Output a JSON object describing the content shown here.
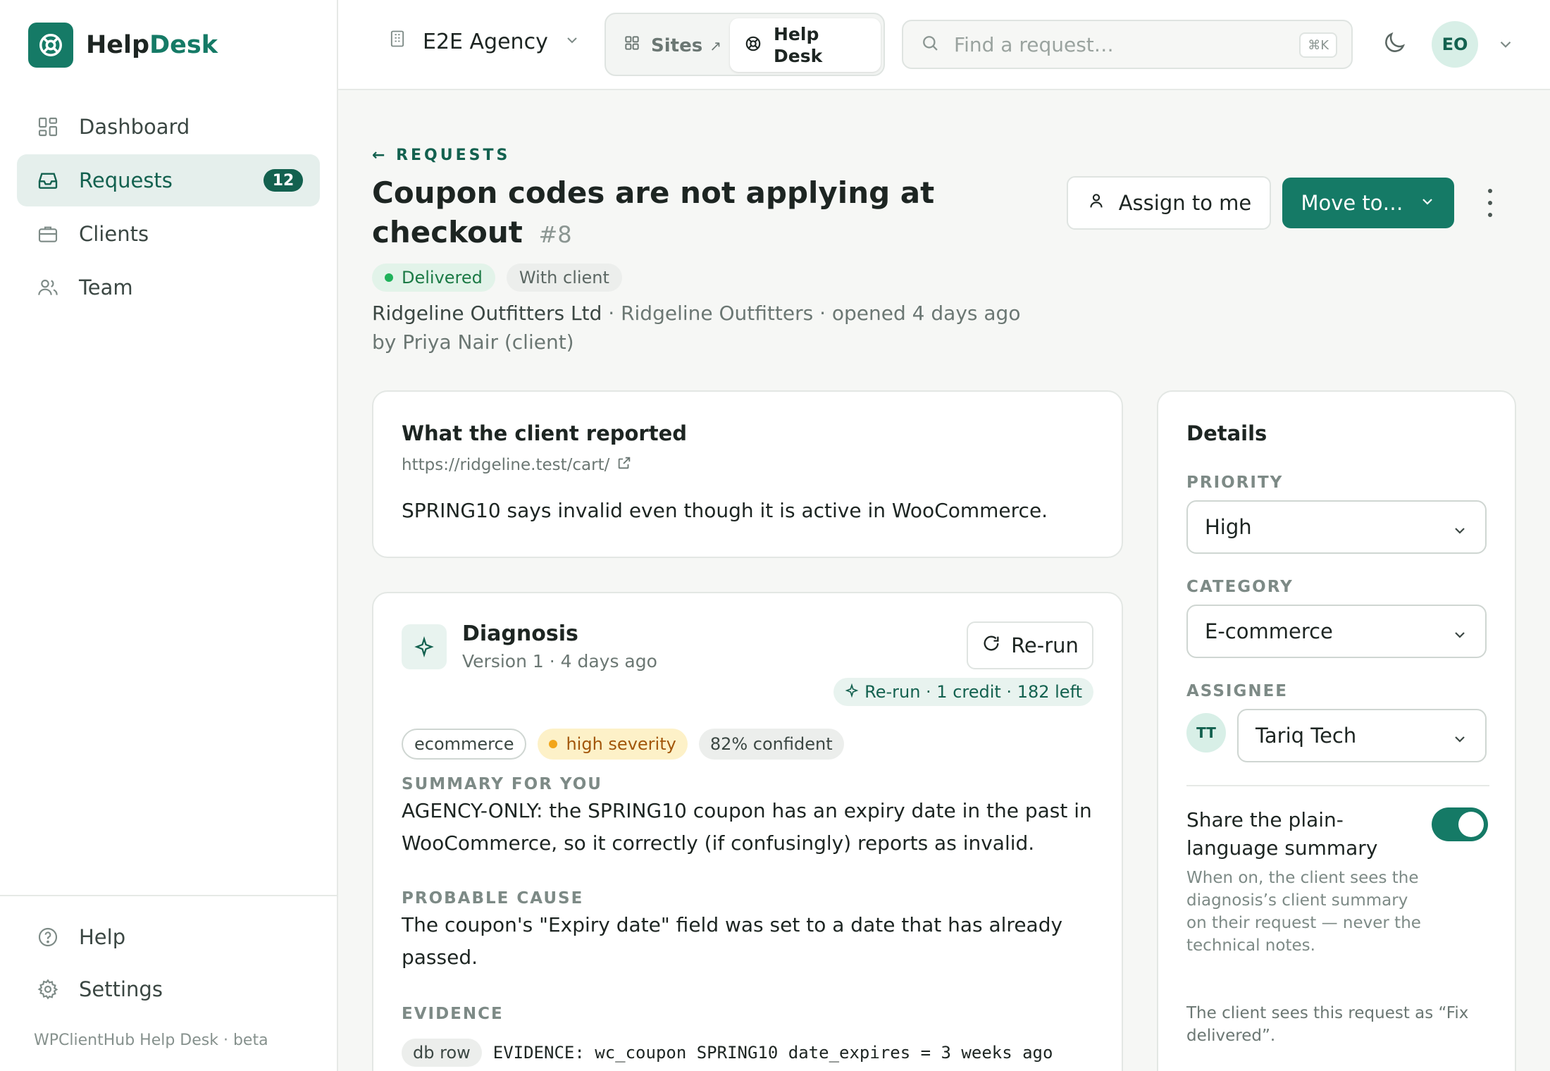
{
  "brand": {
    "prefix": "Help",
    "accent": "Desk"
  },
  "sidebar": {
    "items": [
      {
        "label": "Dashboard",
        "icon": "grid-icon"
      },
      {
        "label": "Requests",
        "icon": "inbox-icon",
        "badge": "12",
        "active": true
      },
      {
        "label": "Clients",
        "icon": "briefcase-icon"
      },
      {
        "label": "Team",
        "icon": "users-icon"
      }
    ],
    "bottom": [
      {
        "label": "Help",
        "icon": "help-circle-icon"
      },
      {
        "label": "Settings",
        "icon": "gear-icon"
      }
    ],
    "footer": "WPClientHub Help Desk · beta"
  },
  "topbar": {
    "agency": "E2E Agency",
    "switch_sites": "Sites",
    "switch_sites_ext": "↗",
    "switch_helpdesk": "Help Desk",
    "search_placeholder": "Find a request…",
    "search_shortcut": "⌘K",
    "avatar": "EO"
  },
  "request": {
    "back": "← REQUESTS",
    "title": "Coupon codes are not applying at checkout",
    "number": "#8",
    "status": "Delivered",
    "state": "With client",
    "company": "Ridgeline Outfitters Ltd",
    "meta_rest": " · Ridgeline Outfitters · opened 4 days ago by Priya Nair (client)"
  },
  "actions": {
    "assign": "Assign to me",
    "move": "Move to…"
  },
  "reported": {
    "heading": "What the client reported",
    "url": "https://ridgeline.test/cart/",
    "body": "SPRING10 says invalid even though it is active in WooCommerce."
  },
  "diagnosis": {
    "title": "Diagnosis",
    "subtitle": "Version 1 · 4 days ago",
    "rerun": "Re-run",
    "rerun_credit": "Re-run · 1 credit · 182 left",
    "tags": {
      "category": "ecommerce",
      "severity": "high severity",
      "confidence": "82% confident"
    },
    "summary_label": "SUMMARY FOR YOU",
    "summary": "AGENCY-ONLY: the SPRING10 coupon has an expiry date in the past in WooCommerce, so it correctly (if confusingly) reports as invalid.",
    "cause_label": "PROBABLE CAUSE",
    "cause": "The coupon's \"Expiry date\" field was set to a date that has already passed.",
    "evidence_label": "EVIDENCE",
    "evidence_type": "db row",
    "evidence_text": "EVIDENCE: wc_coupon SPRING10 date_expires = 3 weeks ago"
  },
  "details": {
    "title": "Details",
    "priority_label": "PRIORITY",
    "priority": "High",
    "category_label": "CATEGORY",
    "category": "E-commerce",
    "assignee_label": "ASSIGNEE",
    "assignee_initials": "TT",
    "assignee": "Tariq Tech",
    "share_title": "Share the plain-language summary",
    "share_on": true,
    "share_desc": "When on, the client sees the diagnosis’s client summary on their request — never the technical notes.",
    "client_view": "The client sees this request as “Fix delivered”."
  },
  "colors": {
    "brand": "#157a66",
    "brand_dark": "#13614f",
    "delivered": "#1fb25a",
    "severity": "#f2a51a"
  }
}
